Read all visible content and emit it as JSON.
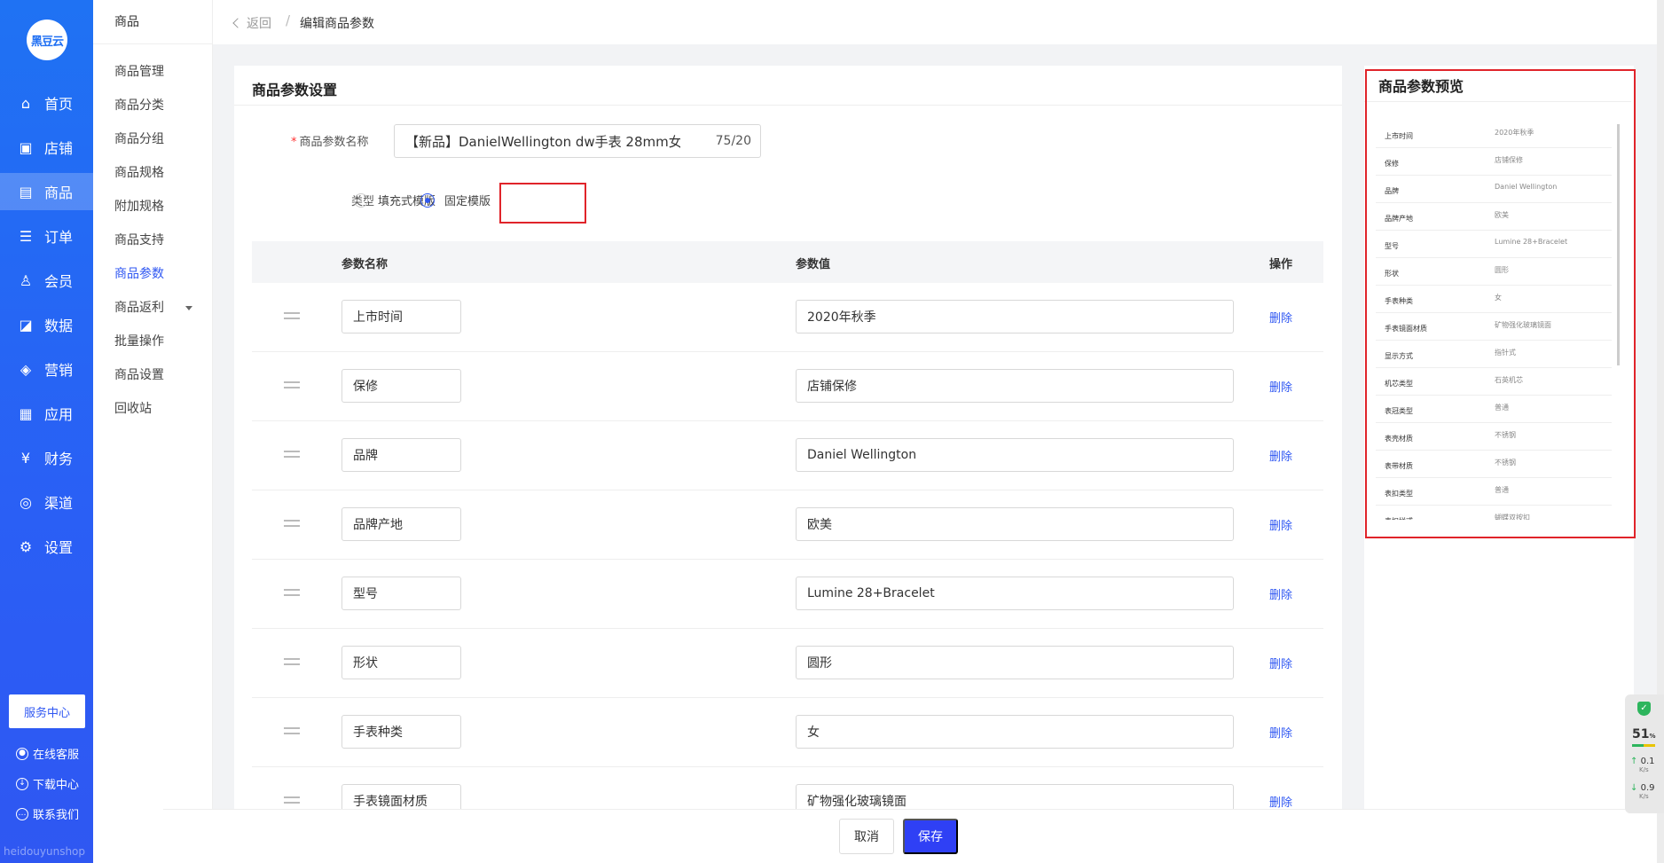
{
  "logo": {
    "text": "黑豆云"
  },
  "nav": [
    {
      "label": "首页",
      "icon": "home-icon",
      "glyph": "⌂"
    },
    {
      "label": "店铺",
      "icon": "store-icon",
      "glyph": "▣"
    },
    {
      "label": "商品",
      "icon": "goods-icon",
      "glyph": "▤"
    },
    {
      "label": "订单",
      "icon": "order-icon",
      "glyph": "☰"
    },
    {
      "label": "会员",
      "icon": "member-icon",
      "glyph": "♙"
    },
    {
      "label": "数据",
      "icon": "data-icon",
      "glyph": "◪"
    },
    {
      "label": "营销",
      "icon": "tag-icon",
      "glyph": "◈"
    },
    {
      "label": "应用",
      "icon": "app-icon",
      "glyph": "▦"
    },
    {
      "label": "财务",
      "icon": "finance-icon",
      "glyph": "¥"
    },
    {
      "label": "渠道",
      "icon": "channel-icon",
      "glyph": "◎"
    },
    {
      "label": "设置",
      "icon": "settings-icon",
      "glyph": "⚙"
    }
  ],
  "nav_active": "商品",
  "service_center": "服务中心",
  "bottom_links": [
    {
      "label": "在线客服",
      "glyph": "●"
    },
    {
      "label": "下载中心",
      "glyph": "↓"
    },
    {
      "label": "联系我们",
      "glyph": "…"
    }
  ],
  "brand_bottom": "heidouyunshop",
  "subnav": {
    "title": "商品",
    "items": [
      "商品管理",
      "商品分类",
      "商品分组",
      "商品规格",
      "附加规格",
      "商品支持",
      "商品参数",
      "商品返利",
      "批量操作",
      "商品设置",
      "回收站"
    ],
    "active": "商品参数"
  },
  "breadcrumb": {
    "back": "返回",
    "separator": "/",
    "current": "编辑商品参数"
  },
  "form": {
    "card_title": "商品参数设置",
    "required_mark": "*",
    "name_label": "商品参数名称",
    "name_value": "【新品】DanielWellington dw手表 28mm女士",
    "name_count": "75/20",
    "type_label": "类型",
    "type_options": [
      "填充式模版",
      "固定模版"
    ],
    "type_selected": "固定模版"
  },
  "table": {
    "headers": [
      "参数名称",
      "参数值",
      "操作"
    ],
    "delete_label": "删除",
    "rows": [
      {
        "name": "上市时间",
        "value": "2020年秋季"
      },
      {
        "name": "保修",
        "value": "店铺保修"
      },
      {
        "name": "品牌",
        "value": "Daniel Wellington"
      },
      {
        "name": "品牌产地",
        "value": "欧美"
      },
      {
        "name": "型号",
        "value": "Lumine 28+Bracelet"
      },
      {
        "name": "形状",
        "value": "圆形"
      },
      {
        "name": "手表种类",
        "value": "女"
      },
      {
        "name": "手表镜面材质",
        "value": "矿物强化玻璃镜面"
      }
    ]
  },
  "preview": {
    "title": "商品参数预览",
    "rows": [
      {
        "k": "上市时间",
        "v": "2020年秋季"
      },
      {
        "k": "保修",
        "v": "店铺保修"
      },
      {
        "k": "品牌",
        "v": "Daniel Wellington"
      },
      {
        "k": "品牌产地",
        "v": "欧美"
      },
      {
        "k": "型号",
        "v": "Lumine 28+Bracelet"
      },
      {
        "k": "形状",
        "v": "圆形"
      },
      {
        "k": "手表种类",
        "v": "女"
      },
      {
        "k": "手表镜面材质",
        "v": "矿物强化玻璃镜面"
      },
      {
        "k": "显示方式",
        "v": "指针式"
      },
      {
        "k": "机芯类型",
        "v": "石英机芯"
      },
      {
        "k": "表冠类型",
        "v": "普通"
      },
      {
        "k": "表壳材质",
        "v": "不锈钢"
      },
      {
        "k": "表带材质",
        "v": "不锈钢"
      },
      {
        "k": "表扣类型",
        "v": "普通"
      },
      {
        "k": "表扣样式",
        "v": "蝴蝶双按扣"
      }
    ]
  },
  "footer": {
    "cancel": "取消",
    "save": "保存"
  },
  "widget": {
    "percent": "51",
    "percent_unit": "%",
    "up": "0.1",
    "down": "0.9",
    "unit": "K/s"
  },
  "colors": {
    "primary": "#2f57f2",
    "highlight": "#e0242a",
    "nav_bg": "#1f72f3"
  }
}
